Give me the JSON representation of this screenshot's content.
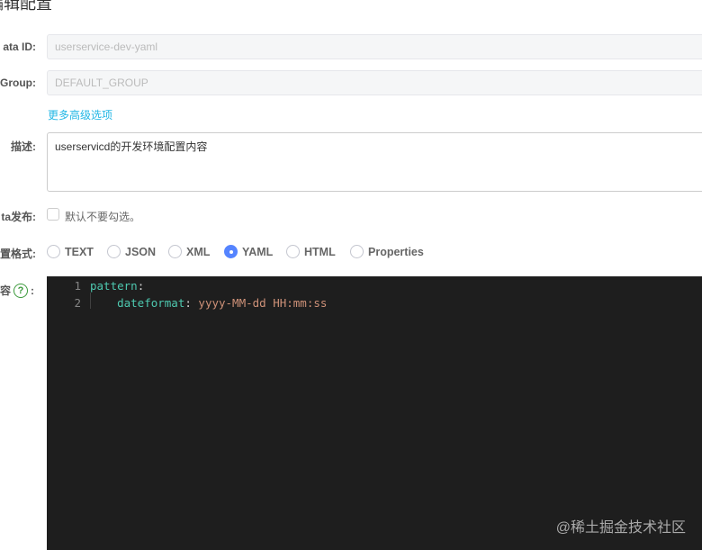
{
  "page_title": "编辑配置",
  "fields": {
    "data_id": {
      "label": "ata ID:",
      "value": "userservice-dev-yaml"
    },
    "group": {
      "label": "Group:",
      "value": "DEFAULT_GROUP"
    },
    "advanced_link": "更多高级选项",
    "description": {
      "label": "描述:",
      "value": "userservicd的开发环境配置内容"
    },
    "beta": {
      "label": "ta发布:",
      "checkbox_label": "默认不要勾选。",
      "checked": false
    },
    "format": {
      "label": "置格式:",
      "options": [
        "TEXT",
        "JSON",
        "XML",
        "YAML",
        "HTML",
        "Properties"
      ],
      "selected": "YAML"
    },
    "content": {
      "label": "容",
      "help_icon": "?",
      "colon": ":"
    }
  },
  "editor": {
    "lines": [
      {
        "num": "1",
        "key": "pattern",
        "sep": ":",
        "value": ""
      },
      {
        "num": "2",
        "key": "    dateformat",
        "sep": ": ",
        "value": "yyyy-MM-dd HH:mm:ss"
      }
    ]
  },
  "watermark": "@稀土掘金技术社区"
}
